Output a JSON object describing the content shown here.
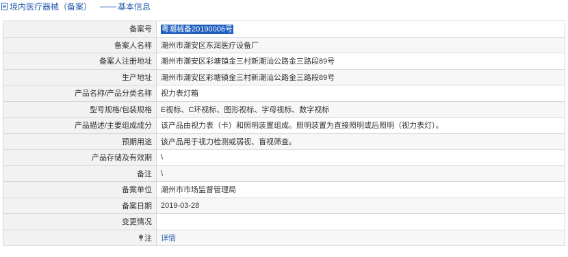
{
  "header": {
    "title": "境内医疗器械（备案）",
    "separator": "——",
    "subtitle": "基本信息"
  },
  "rows": [
    {
      "label": "备案号",
      "value": "粤潮械备20190006号"
    },
    {
      "label": "备案人名称",
      "value": "潮州市潮安区东润医疗设备厂"
    },
    {
      "label": "备案人注册地址",
      "value": "潮州市潮安区彩塘镇金三村新潮汕公路金三路段89号"
    },
    {
      "label": "生产地址",
      "value": "潮州市潮安区彩塘镇金三村新潮汕公路金三路段89号"
    },
    {
      "label": "产品名称/产品分类名称",
      "value": "视力表灯箱"
    },
    {
      "label": "型号规格/包装规格",
      "value": "E视标、C环视标、图形视标、字母视标、数字视标"
    },
    {
      "label": "产品描述/主要组成成分",
      "value": "该产品由视力表（卡）和照明装置组成。照明装置为直接照明或后照明（视力表灯）。"
    },
    {
      "label": "预期用途",
      "value": "该产品用于视力检测或弱视、盲视筛查。"
    },
    {
      "label": "产品存储及有效期",
      "value": "\\"
    },
    {
      "label": "备注",
      "value": "\\"
    },
    {
      "label": "备案单位",
      "value": "潮州市市场监督管理局"
    },
    {
      "label": "备案日期",
      "value": "2019-03-28"
    },
    {
      "label": "变更情况",
      "value": ""
    },
    {
      "label": "注",
      "value": "详情"
    }
  ],
  "colors": {
    "header_text": "#2a5db0",
    "border": "#d3d8e0",
    "label_bg": "#f2f2f2",
    "selection_bg": "#1f5fbf",
    "link": "#2a5db0"
  },
  "icons": {
    "header": "document-icon",
    "note": "pin-icon"
  }
}
